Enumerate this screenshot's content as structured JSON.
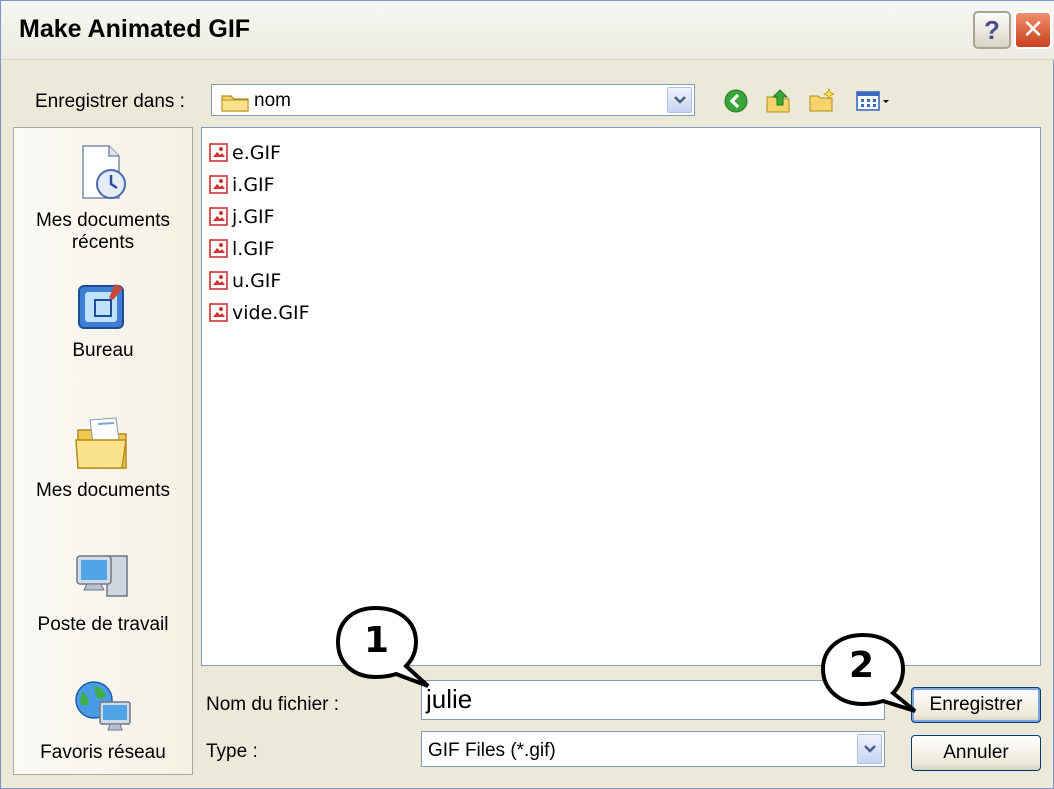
{
  "window": {
    "title": "Make Animated GIF",
    "help_glyph": "?",
    "close_glyph": "✕"
  },
  "location": {
    "label": "Enregistrer dans :",
    "value": "nom"
  },
  "toolbar_icons": [
    "back-icon",
    "up-folder-icon",
    "new-folder-icon",
    "view-menu-icon"
  ],
  "places": [
    {
      "id": "recent",
      "label": "Mes documents récents",
      "icon": "recent-documents-icon"
    },
    {
      "id": "desktop",
      "label": "Bureau",
      "icon": "desktop-icon"
    },
    {
      "id": "documents",
      "label": "Mes documents",
      "icon": "my-documents-icon"
    },
    {
      "id": "computer",
      "label": "Poste de travail",
      "icon": "my-computer-icon"
    },
    {
      "id": "network",
      "label": "Favoris réseau",
      "icon": "network-places-icon"
    }
  ],
  "files": [
    "e.GIF",
    "i.GIF",
    "j.GIF",
    "l.GIF",
    "u.GIF",
    "vide.GIF"
  ],
  "filename": {
    "label": "Nom du fichier :",
    "value": "julie"
  },
  "filetype": {
    "label": "Type :",
    "value": "GIF Files (*.gif)"
  },
  "buttons": {
    "save": "Enregistrer",
    "cancel": "Annuler"
  },
  "callouts": {
    "one": "1",
    "two": "2"
  },
  "colors": {
    "title_close": "#c9411d",
    "border_blue": "#7f9db9",
    "dialog_bg": "#ece9d8"
  }
}
